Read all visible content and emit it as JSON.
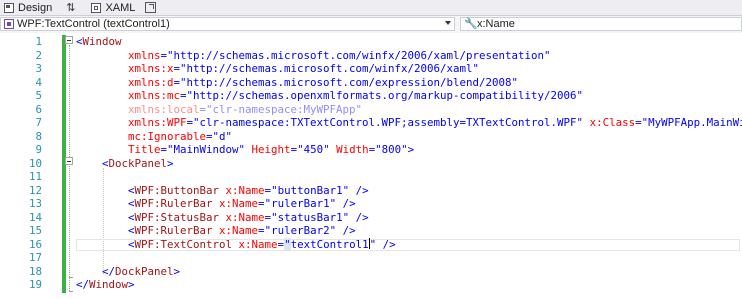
{
  "tabs": [
    {
      "label": "Design",
      "icon": "design-view-icon"
    },
    {
      "label": "",
      "icon": "swap-panes-icon"
    },
    {
      "label": "XAML",
      "icon": "xaml-view-icon"
    },
    {
      "label": "",
      "icon": "popout-icon"
    }
  ],
  "nav": {
    "element_combo": "WPF:TextControl (textControl1)",
    "property_combo": "x:Name"
  },
  "code": [
    {
      "n": "1",
      "parts": [
        [
          "pun",
          "<"
        ],
        [
          "tag",
          "Window"
        ]
      ]
    },
    {
      "n": "2",
      "parts": [
        [
          "attr",
          "        xmlns"
        ],
        [
          "pun",
          "="
        ],
        [
          "val",
          "\"http://schemas.microsoft.com/winfx/2006/xaml/presentation\""
        ]
      ]
    },
    {
      "n": "3",
      "parts": [
        [
          "attr",
          "        xmlns:x"
        ],
        [
          "pun",
          "="
        ],
        [
          "val",
          "\"http://schemas.microsoft.com/winfx/2006/xaml\""
        ]
      ]
    },
    {
      "n": "4",
      "parts": [
        [
          "attr",
          "        xmlns:d"
        ],
        [
          "pun",
          "="
        ],
        [
          "val",
          "\"http://schemas.microsoft.com/expression/blend/2008\""
        ]
      ]
    },
    {
      "n": "5",
      "parts": [
        [
          "attr",
          "        xmlns:mc"
        ],
        [
          "pun",
          "="
        ],
        [
          "val",
          "\"http://schemas.openxmlformats.org/markup-compatibility/2006\""
        ]
      ]
    },
    {
      "n": "6",
      "parts": [
        [
          "dimattr",
          "        xmlns:local"
        ],
        [
          "dimpun",
          "="
        ],
        [
          "dimval",
          "\"clr-namespace:MyWPFApp\""
        ]
      ]
    },
    {
      "n": "7",
      "parts": [
        [
          "attr",
          "        xmlns:WPF"
        ],
        [
          "pun",
          "="
        ],
        [
          "val",
          "\"clr-namespace:TXTextControl.WPF;assembly=TXTextControl.WPF\""
        ],
        [
          "attr",
          " x:Class"
        ],
        [
          "pun",
          "="
        ],
        [
          "val",
          "\"MyWPFApp.MainWindow\""
        ]
      ]
    },
    {
      "n": "8",
      "parts": [
        [
          "attr",
          "        mc:Ignorable"
        ],
        [
          "pun",
          "="
        ],
        [
          "val",
          "\"d\""
        ]
      ]
    },
    {
      "n": "9",
      "parts": [
        [
          "attr",
          "        Title"
        ],
        [
          "pun",
          "="
        ],
        [
          "val",
          "\"MainWindow\""
        ],
        [
          "attr",
          " Height"
        ],
        [
          "pun",
          "="
        ],
        [
          "val",
          "\"450\""
        ],
        [
          "attr",
          " Width"
        ],
        [
          "pun",
          "="
        ],
        [
          "val",
          "\"800\""
        ],
        [
          "pun",
          ">"
        ]
      ]
    },
    {
      "n": "10",
      "parts": [
        [
          "pun",
          "    <"
        ],
        [
          "tag",
          "DockPanel"
        ],
        [
          "pun",
          ">"
        ]
      ]
    },
    {
      "n": "11",
      "parts": []
    },
    {
      "n": "12",
      "parts": [
        [
          "pun",
          "        <"
        ],
        [
          "tag",
          "WPF:ButtonBar"
        ],
        [
          "attr",
          " x:Name"
        ],
        [
          "pun",
          "="
        ],
        [
          "val",
          "\"buttonBar1\""
        ],
        [
          "pun",
          " />"
        ]
      ]
    },
    {
      "n": "13",
      "parts": [
        [
          "pun",
          "        <"
        ],
        [
          "tag",
          "WPF:RulerBar"
        ],
        [
          "attr",
          " x:Name"
        ],
        [
          "pun",
          "="
        ],
        [
          "val",
          "\"rulerBar1\""
        ],
        [
          "pun",
          " />"
        ]
      ]
    },
    {
      "n": "14",
      "parts": [
        [
          "pun",
          "        <"
        ],
        [
          "tag",
          "WPF:StatusBar"
        ],
        [
          "attr",
          " x:Name"
        ],
        [
          "pun",
          "="
        ],
        [
          "val",
          "\"statusBar1\""
        ],
        [
          "pun",
          " />"
        ]
      ]
    },
    {
      "n": "15",
      "parts": [
        [
          "pun",
          "        <"
        ],
        [
          "tag",
          "WPF:RulerBar"
        ],
        [
          "attr",
          " x:Name"
        ],
        [
          "pun",
          "="
        ],
        [
          "val",
          "\"rulerBar2\""
        ],
        [
          "pun",
          " />"
        ]
      ]
    },
    {
      "n": "16",
      "parts": [
        [
          "pun",
          "        <"
        ],
        [
          "tag",
          "WPF:TextControl"
        ],
        [
          "attr",
          " x:Name"
        ],
        [
          "pun",
          "="
        ],
        [
          "selval",
          "\""
        ],
        [
          "val",
          "textControl1"
        ],
        [
          "caret",
          ""
        ],
        [
          "val",
          "\""
        ],
        [
          "pun",
          " />"
        ]
      ]
    },
    {
      "n": "17",
      "parts": []
    },
    {
      "n": "18",
      "parts": [
        [
          "pun",
          "    </"
        ],
        [
          "tag",
          "DockPanel"
        ],
        [
          "pun",
          ">"
        ]
      ]
    },
    {
      "n": "19",
      "parts": [
        [
          "pun",
          "</"
        ],
        [
          "tag",
          "Window"
        ],
        [
          "pun",
          ">"
        ]
      ]
    }
  ],
  "current_line": 16,
  "colors": {
    "line_number": "#2b91af",
    "tag": "#a31515",
    "attribute": "#ff0000",
    "value": "#0000ff",
    "change_bar": "#3cb043"
  }
}
